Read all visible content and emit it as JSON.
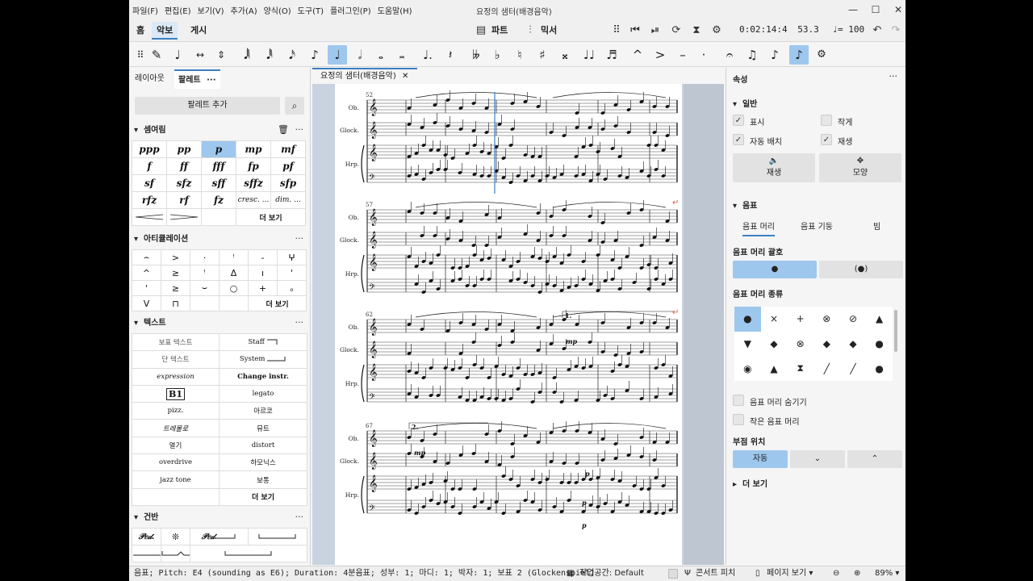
{
  "window": {
    "title": "요정의 샘터(배경음악)",
    "menus": [
      "파일(F)",
      "편집(E)",
      "보기(V)",
      "추가(A)",
      "양식(O)",
      "도구(T)",
      "플러그인(P)",
      "도움말(H)"
    ],
    "controls": {
      "minimize": "—",
      "maximize": "☐",
      "close": "✕"
    }
  },
  "topbar": {
    "tabs": [
      {
        "label": "홈"
      },
      {
        "label": "악보"
      },
      {
        "label": "게시"
      }
    ],
    "active_tab": "악보",
    "parts_label": "파트",
    "mixer_label": "믹서",
    "timecode": "0:02:14:4",
    "measure_beat": "53.3",
    "tempo": "♩= 100"
  },
  "palettes": {
    "tabs": {
      "layout": "레이아웃",
      "palette": "팔레트",
      "more": "···"
    },
    "add_palette": "팔레트 추가",
    "dynamics": {
      "title": "셈여림",
      "items": [
        "ppp",
        "pp",
        "p",
        "mp",
        "mf",
        "f",
        "ff",
        "fff",
        "fp",
        "pf",
        "sf",
        "sfz",
        "sff",
        "sffz",
        "sfp",
        "rfz",
        "rf",
        "fz",
        "cresc. ...",
        "dim. ..."
      ],
      "selected": "p",
      "more": "더 보기"
    },
    "articulations": {
      "title": "아티큘레이션",
      "items": [
        "⌢",
        ">",
        "·",
        "ꜝ",
        "-",
        "ⵖ",
        "^",
        "≥",
        "ꜝ",
        "Δ",
        "ı",
        "ꞌ",
        "ꞌ",
        "≥",
        "⌣",
        "○",
        "+",
        "ₒ",
        "V",
        "⊓"
      ],
      "more": "더 보기"
    },
    "text": {
      "title": "텍스트",
      "items": [
        "보표 텍스트",
        "Staff",
        "단 텍스트",
        "System",
        "expression",
        "Change instr.",
        "B1",
        "legato",
        "pizz.",
        "아르코",
        "트레몰로",
        "뮤트",
        "열기",
        "distort",
        "overdrive",
        "하모닉스",
        "jazz tone",
        "보통",
        "",
        "더 보기"
      ]
    },
    "keyboard": {
      "title": "건반",
      "items": [
        "𝒫𝑒𝒹.",
        "❊",
        "𝒫𝑒𝒹.",
        "",
        "",
        "",
        ""
      ]
    }
  },
  "score": {
    "tab_title": "요정의 샘터(배경음악)",
    "instruments": [
      "Ob.",
      "Glock.",
      "Hrp."
    ],
    "systems": [
      {
        "measure": "52"
      },
      {
        "measure": "57"
      },
      {
        "measure": "62",
        "volta": "1."
      },
      {
        "measure": "67",
        "volta": "2."
      }
    ],
    "dynamics_marks": [
      "mp",
      "mp",
      "p",
      "p",
      "p"
    ]
  },
  "properties": {
    "title": "속성",
    "more": "···",
    "general": {
      "title": "일반",
      "visible": "표시",
      "cue": "작게",
      "auto_place": "자동 배치",
      "play": "재생",
      "play_btn": "재생",
      "appearance_btn": "모양"
    },
    "note": {
      "title": "음표",
      "tabs": [
        "음표 머리",
        "음표 기둥",
        "빔"
      ],
      "head_bracket_title": "음표 머리 괄호",
      "head_bracket_options": [
        "●",
        "(●)"
      ],
      "head_type_title": "음표 머리 종류",
      "head_types": [
        "●",
        "×",
        "+",
        "⊗",
        "⊘",
        "▲",
        "▼",
        "◆",
        "⊗",
        "◆",
        "◆",
        "●",
        "◉",
        "▲",
        "⧗",
        "╱",
        "╱",
        "●"
      ],
      "hide_head": "음표 머리 숨기기",
      "small_head": "작은 음표 머리",
      "dot_position_title": "부점 위치",
      "dot_positions": [
        "자동",
        "⌄",
        "⌃"
      ],
      "show_more": "더 보기"
    }
  },
  "statusbar": {
    "text": "음표; Pitch: E4 (sounding as E6); Duration: 4분음표; 성부: 1; 마디: 1; 박자: 1; 보표 2 (Glockenspiel)",
    "workspace": "작업공간: Default",
    "concert_pitch": "콘서트 피치",
    "page_view": "페이지 보기",
    "zoom": "89%"
  },
  "colors": {
    "accent": "#3b7fc4",
    "selection": "#9ec7ee",
    "canvas": "#c9d3df"
  }
}
